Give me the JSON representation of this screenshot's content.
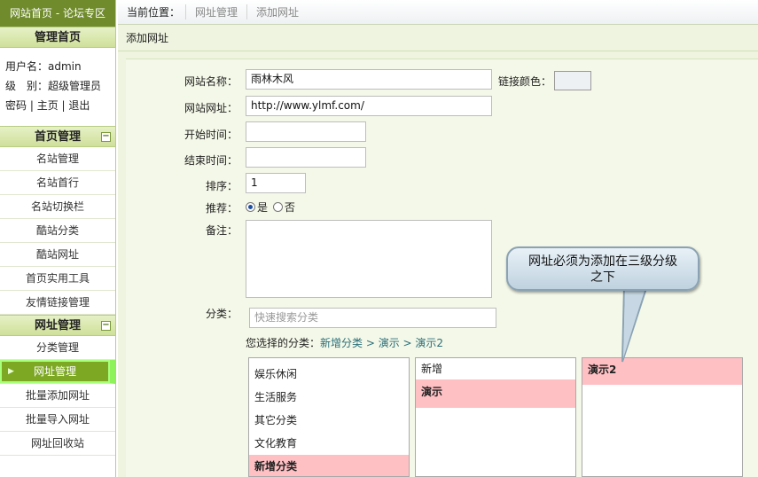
{
  "sidebar": {
    "top_links": "网站首页 - 论坛专区",
    "home_title": "管理首页",
    "user": {
      "username_label": "用户名：",
      "username": "admin",
      "level_label": "级　别：",
      "level": "超级管理员",
      "links": [
        "密码",
        "主页",
        "退出"
      ]
    },
    "sections": [
      {
        "title": "首页管理",
        "collapse": "−",
        "items": [
          "名站管理",
          "名站首行",
          "名站切换栏",
          "酷站分类",
          "酷站网址",
          "首页实用工具",
          "友情链接管理"
        ]
      },
      {
        "title": "网址管理",
        "collapse": "−",
        "items": [
          "分类管理",
          "网址管理",
          "批量添加网址",
          "批量导入网址",
          "网址回收站"
        ],
        "active_index": 1
      }
    ]
  },
  "breadcrumb": {
    "label": "当前位置：",
    "items": [
      "网址管理",
      "添加网址"
    ]
  },
  "panel_title": "添加网址",
  "form": {
    "name_label": "网站名称：",
    "name_value": "雨林木风",
    "color_label": "链接颜色：",
    "url_label": "网站网址：",
    "url_value": "http://www.ylmf.com/",
    "start_label": "开始时间：",
    "start_value": "",
    "end_label": "结束时间：",
    "end_value": "",
    "order_label": "排序：",
    "order_value": "1",
    "recommend_label": "推荐：",
    "recommend_yes": "是",
    "recommend_no": "否",
    "note_label": "备注：",
    "category_label": "分类：",
    "category_placeholder": "快速搜索分类",
    "selected_label": "您选择的分类：",
    "selected_path": "新增分类 > 演示 > 演示2"
  },
  "categories": {
    "level1": [
      "娱乐休闲",
      "生活服务",
      "其它分类",
      "文化教育",
      "新增分类"
    ],
    "level2": [
      "新增",
      "演示"
    ],
    "level3": [
      "演示2"
    ]
  },
  "tooltip": "网址必须为添加在三级分级之下"
}
